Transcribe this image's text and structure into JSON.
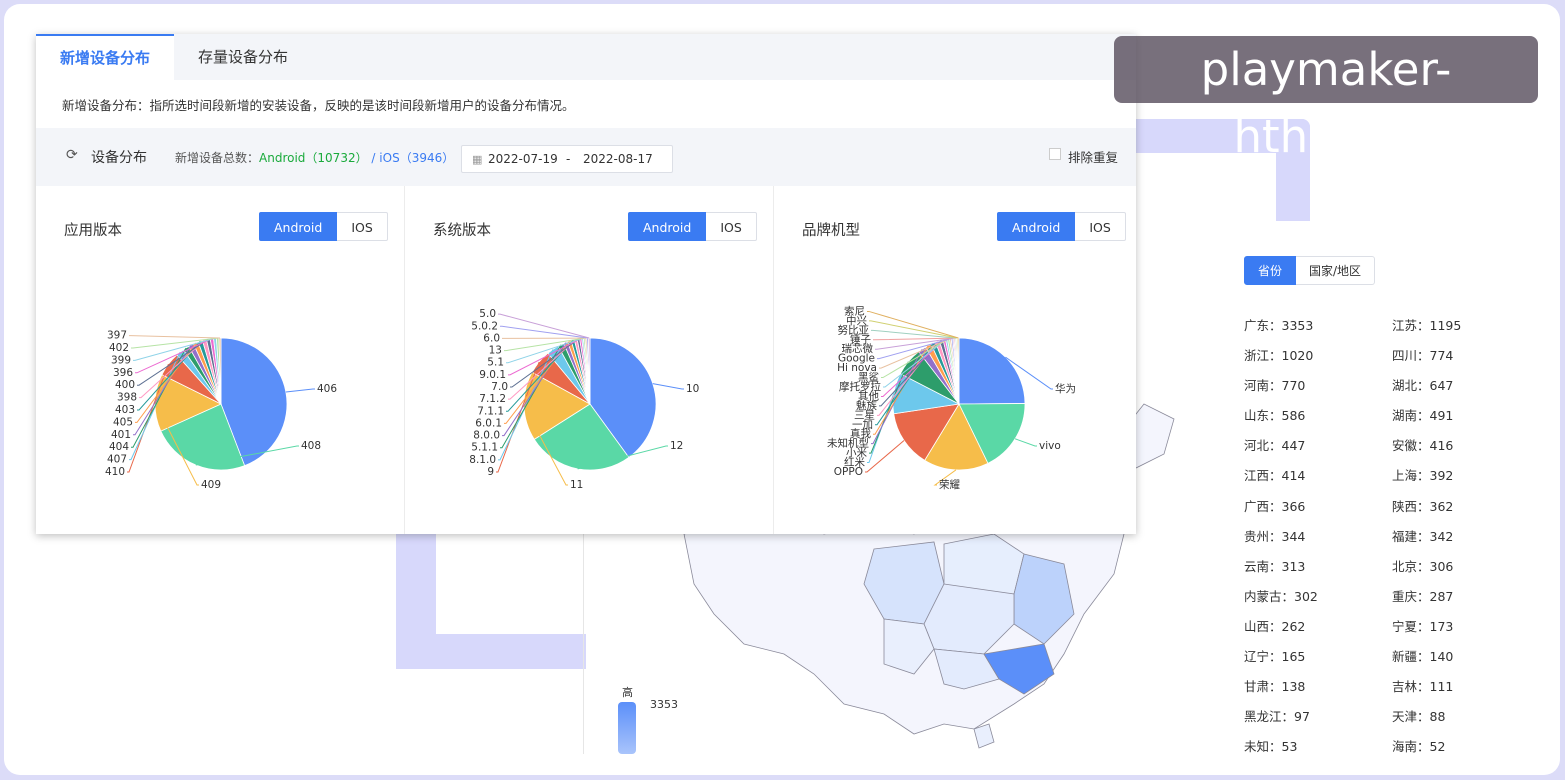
{
  "tabs": [
    {
      "label": "新增设备分布",
      "active": true
    },
    {
      "label": "存量设备分布",
      "active": false
    }
  ],
  "description": "新增设备分布：指所选时间段新增的安装设备，反映的是该时间段新增用户的设备分布情况。",
  "toolbar": {
    "title": "设备分布",
    "total_prefix": "新增设备总数：",
    "android_text": "Android（10732）",
    "separator": "/",
    "ios_text": "iOS（3946）",
    "date_start": "2022-07-19",
    "date_sep": "-",
    "date_end": "2022-08-17",
    "dedupe_label": "排除重复"
  },
  "panels": [
    {
      "title": "应用版本",
      "seg": [
        "Android",
        "IOS"
      ],
      "chart_data": {
        "type": "pie",
        "labels": [
          "406",
          "408",
          "409",
          "410",
          "407",
          "404",
          "401",
          "405",
          "403",
          "398",
          "400",
          "396",
          "399",
          "402",
          "397"
        ],
        "values": [
          44,
          24,
          14,
          6,
          2,
          1.5,
          1.3,
          1.2,
          1.1,
          1,
          0.9,
          0.8,
          0.7,
          0.6,
          0.5
        ],
        "colors": [
          "#5b8ff9",
          "#5ad8a6",
          "#f6bd4a",
          "#e8684a",
          "#6dc8ec",
          "#2d9d6b",
          "#9270ca",
          "#ff9d4d",
          "#269a99",
          "#ff99c3",
          "#5d7092",
          "#ec6ad1",
          "#8fd3e8",
          "#b6e3a5",
          "#e8c1a0"
        ]
      }
    },
    {
      "title": "系统版本",
      "seg": [
        "Android",
        "IOS"
      ],
      "chart_data": {
        "type": "pie",
        "labels": [
          "10",
          "12",
          "11",
          "9",
          "8.1.0",
          "5.1.1",
          "8.0.0",
          "6.0.1",
          "7.1.1",
          "7.1.2",
          "7.0",
          "9.0.1",
          "5.1",
          "13",
          "6.0",
          "5.0.2",
          "5.0"
        ],
        "values": [
          40,
          26,
          17,
          6,
          3,
          1.5,
          1,
          0.9,
          0.8,
          0.7,
          0.6,
          0.5,
          0.4,
          0.4,
          0.4,
          0.4,
          0.4
        ],
        "colors": [
          "#5b8ff9",
          "#5ad8a6",
          "#f6bd4a",
          "#e8684a",
          "#6dc8ec",
          "#2d9d6b",
          "#9270ca",
          "#ff9d4d",
          "#269a99",
          "#ff99c3",
          "#5d7092",
          "#ec6ad1",
          "#8fd3e8",
          "#b6e3a5",
          "#e8c1a0",
          "#a0a0f0",
          "#c8a0d8"
        ]
      }
    },
    {
      "title": "品牌机型",
      "seg": [
        "Android",
        "IOS"
      ],
      "chart_data": {
        "type": "pie",
        "labels": [
          "华为",
          "vivo",
          "荣耀",
          "OPPO",
          "红米",
          "小米",
          "未知机型",
          "真我",
          "一加",
          "三星",
          "魅族",
          "其他",
          "摩托罗拉",
          "黑鲨",
          "Hi nova",
          "Google",
          "瑞芯微",
          "锤子",
          "努比亚",
          "中兴",
          "索尼"
        ],
        "values": [
          25,
          18,
          16,
          14,
          10,
          7,
          2,
          1.5,
          1.2,
          1,
          0.9,
          0.6,
          0.5,
          0.5,
          0.4,
          0.4,
          0.3,
          0.3,
          0.3,
          0.3,
          0.3
        ],
        "colors": [
          "#5b8ff9",
          "#5ad8a6",
          "#f6bd4a",
          "#e8684a",
          "#6dc8ec",
          "#2d9d6b",
          "#9270ca",
          "#ff9d4d",
          "#269a99",
          "#ff99c3",
          "#5d7092",
          "#ec6ad1",
          "#8fd3e8",
          "#b6e3a5",
          "#e8c1a0",
          "#a0a0f0",
          "#c8a0d8",
          "#f0a0a0",
          "#a0d0c0",
          "#d0d070",
          "#e0b060"
        ]
      }
    }
  ],
  "region": {
    "tabs": [
      "省份",
      "国家/地区"
    ],
    "items": [
      "广东：3353",
      "江苏：1195",
      "浙江：1020",
      "四川：774",
      "河南：770",
      "湖北：647",
      "山东：586",
      "湖南：491",
      "河北：447",
      "安徽：416",
      "江西：414",
      "上海：392",
      "广西：366",
      "陕西：362",
      "贵州：344",
      "福建：342",
      "云南：313",
      "北京：306",
      "内蒙古：302",
      "重庆：287",
      "山西：262",
      "宁夏：173",
      "辽宁：165",
      "新疆：140",
      "甘肃：138",
      "吉林：111",
      "黑龙江：97",
      "天津：88",
      "未知：53",
      "海南：52"
    ]
  },
  "map_legend": {
    "high": "高",
    "max_value": "3353"
  },
  "watermark": "playmaker-hth.com"
}
